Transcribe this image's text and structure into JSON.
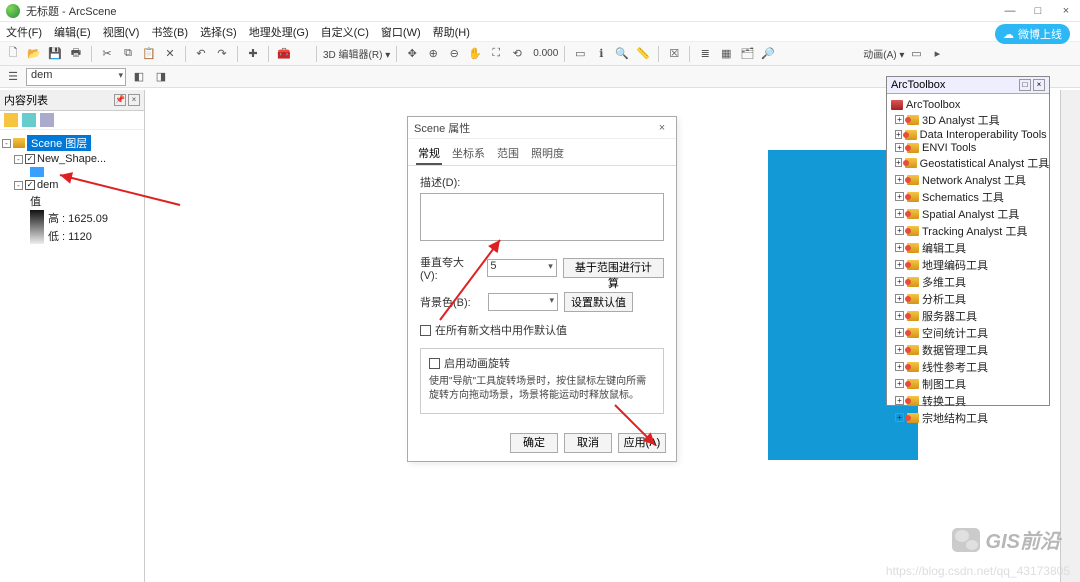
{
  "titlebar": {
    "title": "无标题 - ArcScene",
    "min": "—",
    "max": "□",
    "close": "×"
  },
  "pill": {
    "label": "微博上线",
    "icon": "cloud"
  },
  "menubar": [
    "文件(F)",
    "编辑(E)",
    "视图(V)",
    "书签(B)",
    "选择(S)",
    "地理处理(G)",
    "自定义(C)",
    "窗口(W)",
    "帮助(H)"
  ],
  "layer_selector": {
    "value": "dem"
  },
  "toolbar2": {
    "editor_label": "3D 编辑器(R) ▾",
    "coord": "0.000",
    "anim_label": "动画(A) ▾"
  },
  "toc": {
    "title": "内容列表",
    "scene_root": "Scene 图层",
    "layers": [
      {
        "name": "New_Shape...",
        "checked": true,
        "swatch": "#3aa0ff"
      },
      {
        "name": "dem",
        "checked": true
      }
    ],
    "dem_legend": {
      "label": "值",
      "high_label": "高",
      "high": "1625.09",
      "low_label": "低",
      "low": "1120"
    }
  },
  "dialog": {
    "title": "Scene 属性",
    "close": "×",
    "tabs": [
      "常规",
      "坐标系",
      "范围",
      "照明度"
    ],
    "active_tab": 0,
    "desc_label": "描述(D):",
    "desc_value": "",
    "exag_label": "垂直夸大(V):",
    "exag_value": "5",
    "calc_btn": "基于范围进行计算",
    "bg_label": "背景色(B):",
    "restore_btn": "设置默认值",
    "chk_newdoc": "在所有新文档中用作默认值",
    "chk_anim": "启用动画旋转",
    "anim_help": "使用\"导航\"工具旋转场景时，按住鼠标左键向所需旋转方向拖动场景，场景将能运动时释放鼠标。",
    "ok": "确定",
    "cancel": "取消",
    "apply": "应用(A)"
  },
  "toolbox": {
    "title": "ArcToolbox",
    "root": "ArcToolbox",
    "items": [
      "3D Analyst 工具",
      "Data Interoperability Tools",
      "ENVI Tools",
      "Geostatistical Analyst 工具",
      "Network Analyst 工具",
      "Schematics 工具",
      "Spatial Analyst 工具",
      "Tracking Analyst 工具",
      "编辑工具",
      "地理编码工具",
      "多维工具",
      "分析工具",
      "服务器工具",
      "空间统计工具",
      "数据管理工具",
      "线性参考工具",
      "制图工具",
      "转换工具",
      "宗地结构工具"
    ]
  },
  "watermark": {
    "text": "GIS前沿",
    "url": "https://blog.csdn.net/qq_43173805"
  }
}
